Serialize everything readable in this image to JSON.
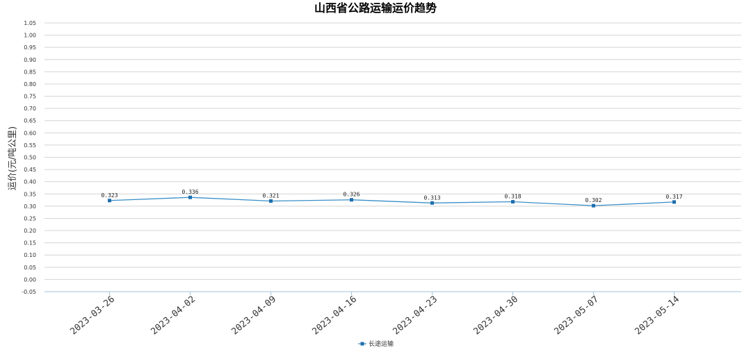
{
  "chart_data": {
    "type": "line",
    "title": "山西省公路运输运价趋势",
    "xlabel": "",
    "ylabel": "运价(元/吨公里)",
    "ylim": [
      -0.05,
      1.05
    ],
    "yticks": [
      "1.05",
      "1.00",
      "0.95",
      "0.90",
      "0.85",
      "0.80",
      "0.75",
      "0.70",
      "0.65",
      "0.60",
      "0.55",
      "0.50",
      "0.45",
      "0.40",
      "0.35",
      "0.30",
      "0.25",
      "0.20",
      "0.15",
      "0.10",
      "0.05",
      "0.00",
      "-0.05"
    ],
    "categories": [
      "2023-03-26",
      "2023-04-02",
      "2023-04-09",
      "2023-04-16",
      "2023-04-23",
      "2023-04-30",
      "2023-05-07",
      "2023-05-14"
    ],
    "series": [
      {
        "name": "长途运输",
        "values": [
          0.323,
          0.336,
          0.321,
          0.326,
          0.313,
          0.318,
          0.302,
          0.317
        ],
        "labels": [
          "0.323",
          "0.336",
          "0.321",
          "0.326",
          "0.313",
          "0.318",
          "0.302",
          "0.317"
        ]
      }
    ],
    "grid": true,
    "legend": "bottom-center",
    "colors": {
      "series": "#3a8fc8",
      "marker": "#1f6fae",
      "grid": "#d4d4d4",
      "axis": "#9fc6d6"
    }
  }
}
